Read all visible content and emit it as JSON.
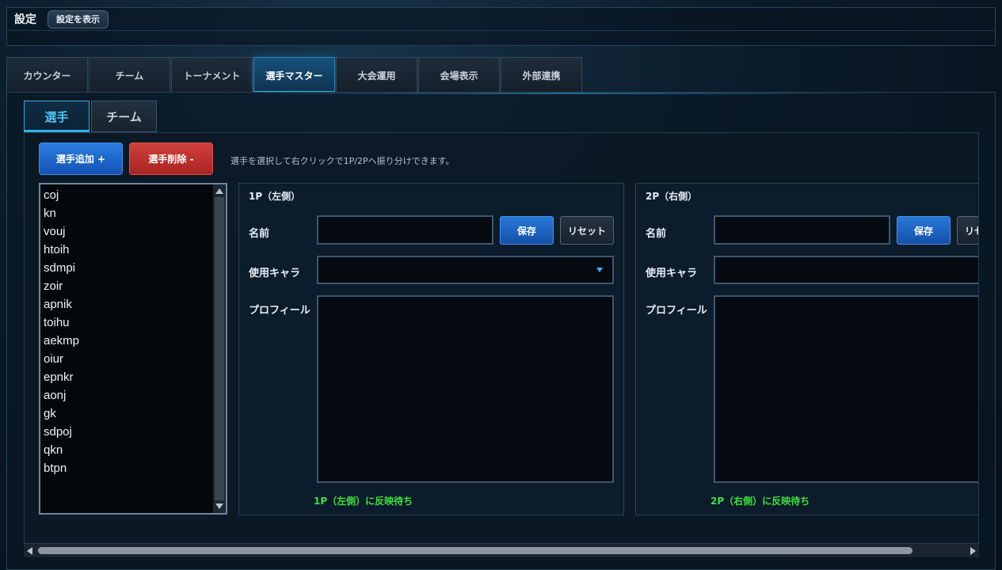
{
  "topbar": {
    "title": "設定",
    "show_button": "設定を表示"
  },
  "tabs": [
    {
      "label": "カウンター"
    },
    {
      "label": "チーム"
    },
    {
      "label": "トーナメント"
    },
    {
      "label": "選手マスター",
      "active": true
    },
    {
      "label": "大会運用"
    },
    {
      "label": "会場表示"
    },
    {
      "label": "外部連携"
    }
  ],
  "subtabs": [
    {
      "label": "選手",
      "active": true
    },
    {
      "label": "チーム"
    }
  ],
  "toolbar": {
    "add_label": "選手追加 +",
    "delete_label": "選手削除 -",
    "hint": "選手を選択して右クリックで1P/2Pへ振り分けできます。"
  },
  "players": [
    "coj",
    "kn",
    "vouj",
    "htoih",
    "sdmpi",
    "zoir",
    "apnik",
    "toihu",
    "aekmp",
    "oiur",
    "epnkr",
    "aonj",
    "gk",
    "sdpoj",
    "qkn",
    "btpn"
  ],
  "p1": {
    "title": "1P（左側）",
    "name_label": "名前",
    "name_value": "",
    "save_label": "保存",
    "reset_label": "リセット",
    "chara_label": "使用キャラ",
    "chara_value": "",
    "profile_label": "プロフィール",
    "profile_value": "",
    "status": "1P（左側）に反映待ち"
  },
  "p2": {
    "title": "2P（右側）",
    "name_label": "名前",
    "name_value": "",
    "save_label": "保存",
    "reset_label": "リセット",
    "chara_label": "使用キャラ",
    "chara_value": "",
    "profile_label": "プロフィール",
    "profile_value": "",
    "status": "2P（右側）に反映待ち"
  },
  "colors": {
    "accent": "#36b4f0",
    "save": "#2878d8",
    "delete": "#c8302c",
    "status": "#3ee03e"
  }
}
